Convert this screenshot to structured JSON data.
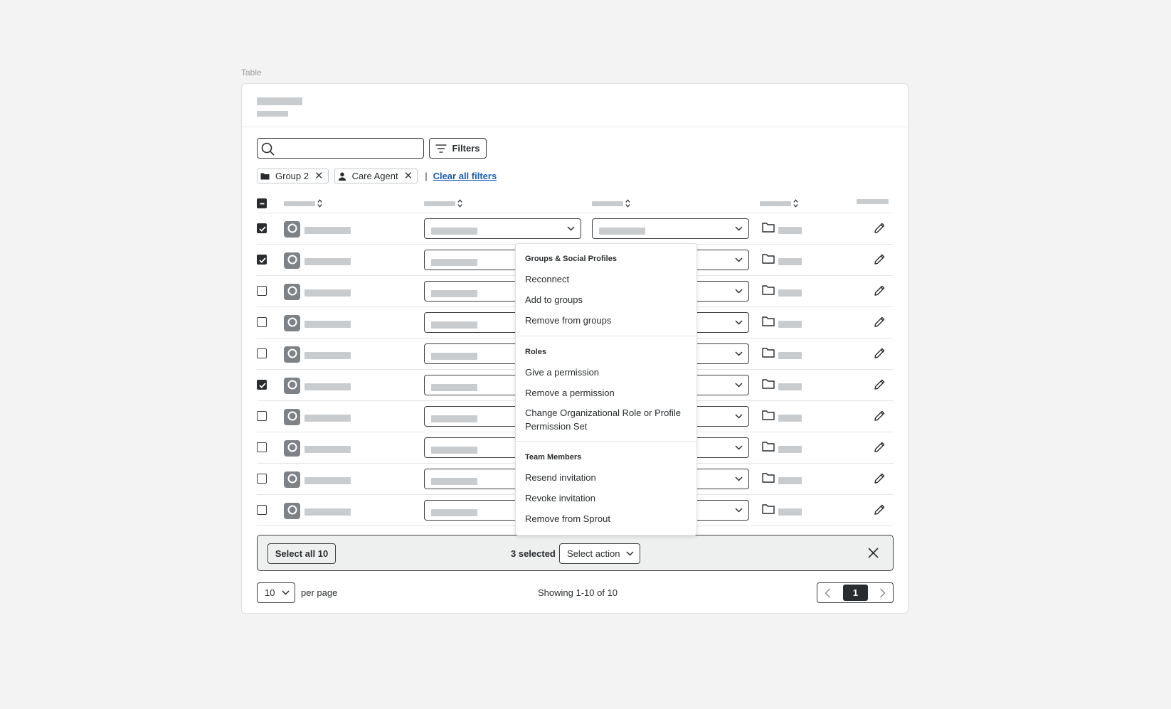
{
  "section_label": "Table",
  "toolbar": {
    "search_placeholder": "",
    "filters_label": "Filters"
  },
  "active_filters": [
    {
      "label": "Group 2",
      "icon": "folder-icon"
    },
    {
      "label": "Care Agent",
      "icon": "user-icon"
    }
  ],
  "separator": "|",
  "clear_all_label": "Clear all filters",
  "rows": [
    {
      "checked": true
    },
    {
      "checked": true
    },
    {
      "checked": false
    },
    {
      "checked": false
    },
    {
      "checked": false
    },
    {
      "checked": true
    },
    {
      "checked": false
    },
    {
      "checked": false
    },
    {
      "checked": false
    },
    {
      "checked": false
    }
  ],
  "action_menu": {
    "groups": [
      {
        "heading": "Groups & Social Profiles",
        "items": [
          "Reconnect",
          "Add to groups",
          "Remove from groups"
        ]
      },
      {
        "heading": "Roles",
        "items": [
          "Give a permission",
          "Remove a permission",
          "Change Organizational Role or Profile Permission Set"
        ]
      },
      {
        "heading": "Team Members",
        "items": [
          "Resend invitation",
          "Revoke invitation",
          "Remove from Sprout"
        ]
      }
    ]
  },
  "bulk_bar": {
    "select_all_label": "Select all 10",
    "selected_text": "3 selected",
    "select_action_label": "Select action"
  },
  "pagination": {
    "per_page_value": "10",
    "per_page_label": "per page",
    "showing_text": "Showing 1-10 of 10",
    "current_page": "1"
  },
  "colors": {
    "background": "#f3f3f3",
    "text": "#2a2d2f",
    "link": "#1c5db5",
    "placeholder": "#c9cccf",
    "bulk_bar_bg": "#eef0f0"
  }
}
